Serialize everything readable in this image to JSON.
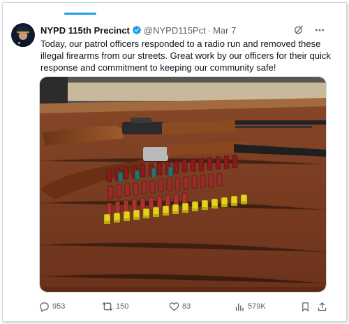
{
  "tweet": {
    "display_name": "NYPD 115th Precinct",
    "handle": "@NYPD115Pct",
    "separator": "·",
    "date": "Mar 7",
    "text": "Today, our patrol officers responded to a radio run and removed these illegal firearms from our streets. Great work by our officers for their quick response and commitment to keeping our community safe!",
    "verified": true,
    "verified_color": "#1d9bf0"
  },
  "photo": {
    "description_icon": "photo-of-seized-firearms"
  },
  "actions": {
    "replies": "953",
    "reposts": "150",
    "likes": "83",
    "views": "579K"
  },
  "icons": {
    "top": [
      "grok-icon",
      "more-icon"
    ],
    "actions": [
      "reply-icon",
      "repost-icon",
      "like-icon",
      "views-icon",
      "bookmark-icon",
      "share-icon"
    ]
  },
  "colors": {
    "accent": "#1d9bf0",
    "text": "#0f1419",
    "muted": "#536471"
  }
}
